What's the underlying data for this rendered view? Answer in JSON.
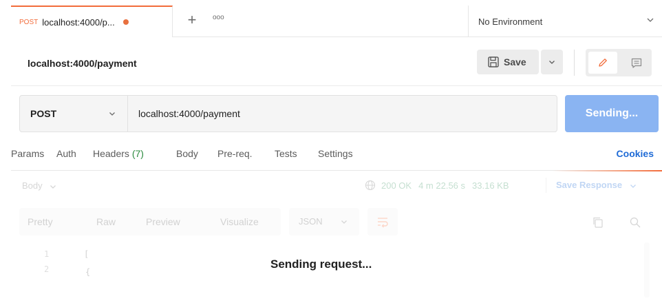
{
  "tab": {
    "method": "POST",
    "title": "localhost:4000/p...",
    "new_tab_label": "+",
    "more_label": "ooo"
  },
  "environment": {
    "label": "No Environment"
  },
  "request": {
    "name": "localhost:4000/payment",
    "save_label": "Save",
    "method": "POST",
    "url": "localhost:4000/payment",
    "send_label": "Sending..."
  },
  "request_tabs": {
    "params": "Params",
    "auth": "Auth",
    "headers": "Headers",
    "headers_count": "(7)",
    "body": "Body",
    "prereq": "Pre-req.",
    "tests": "Tests",
    "settings": "Settings",
    "cookies": "Cookies"
  },
  "response": {
    "body_label": "Body",
    "status": "200 OK",
    "time": "4 m 22.56 s",
    "size": "33.16 KB",
    "save_response": "Save Response",
    "formats": [
      "Pretty",
      "Raw",
      "Preview",
      "Visualize"
    ],
    "language": "JSON",
    "lines": [
      {
        "num": "1",
        "text": "["
      },
      {
        "num": "2",
        "text": "    {"
      }
    ],
    "overlay_message": "Sending request..."
  },
  "colors": {
    "accent": "#f26b3a",
    "send_button": "#8ab4f2",
    "link": "#1f6bd6",
    "status_ok": "#2e8b57"
  },
  "icons": {
    "unsaved": "dot-icon",
    "env_dropdown": "chevron-down-icon",
    "save": "floppy-icon",
    "edit": "pencil-icon",
    "comments": "comment-icon",
    "globe": "globe-icon",
    "wrap": "wrap-lines-icon",
    "copy": "copy-icon",
    "search": "search-icon"
  }
}
